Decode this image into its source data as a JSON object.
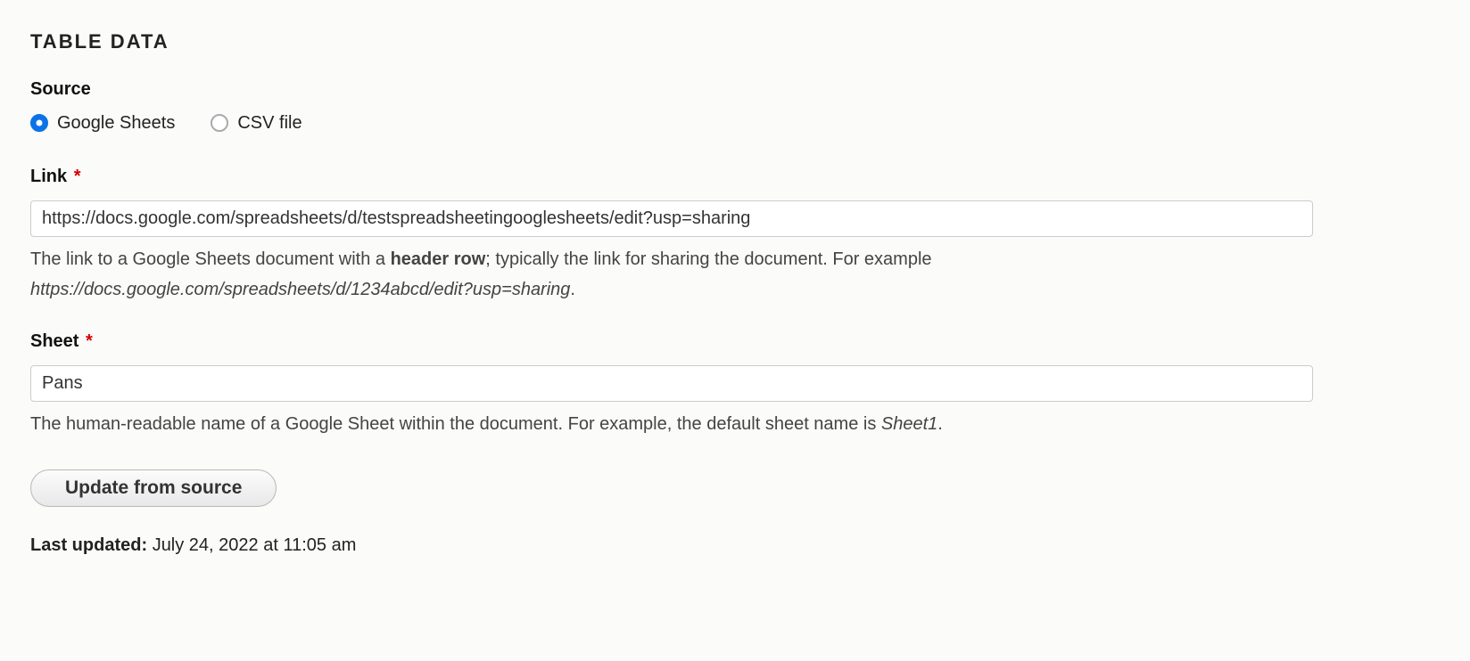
{
  "section_title": "TABLE DATA",
  "source": {
    "label": "Source",
    "options": {
      "google_sheets": "Google Sheets",
      "csv_file": "CSV file"
    },
    "selected": "google_sheets"
  },
  "link": {
    "label": "Link",
    "required": true,
    "value": "https://docs.google.com/spreadsheets/d/testspreadsheetingooglesheets/edit?usp=sharing",
    "help_prefix": "The link to a Google Sheets document with a ",
    "help_bold": "header row",
    "help_mid": "; typically the link for sharing the document. For example ",
    "help_italic": "https://docs.google.com/spreadsheets/d/1234abcd/edit?usp=sharing",
    "help_suffix": "."
  },
  "sheet": {
    "label": "Sheet",
    "required": true,
    "value": "Pans",
    "help_prefix": "The human-readable name of a Google Sheet within the document. For example, the default sheet name is ",
    "help_italic": "Sheet1",
    "help_suffix": "."
  },
  "update_button": "Update from source",
  "last_updated": {
    "label": "Last updated:",
    "value": "July 24, 2022 at 11:05 am"
  },
  "star": "*"
}
